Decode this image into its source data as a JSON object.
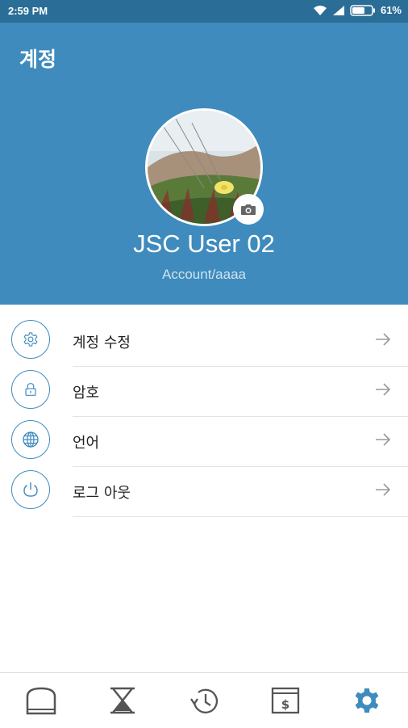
{
  "status_bar": {
    "time": "2:59 PM",
    "battery": "61%"
  },
  "header": {
    "title": "계정",
    "user_name": "JSC User 02",
    "account_id": "Account/aaaa"
  },
  "menu": {
    "items": [
      {
        "label": "계정 수정",
        "icon": "gear-icon"
      },
      {
        "label": "암호",
        "icon": "lock-icon"
      },
      {
        "label": "언어",
        "icon": "globe-icon"
      },
      {
        "label": "로그 아웃",
        "icon": "power-icon"
      }
    ]
  },
  "bottom_nav": {
    "items": [
      {
        "icon": "home-icon",
        "active": false
      },
      {
        "icon": "hourglass-icon",
        "active": false
      },
      {
        "icon": "history-icon",
        "active": false
      },
      {
        "icon": "money-icon",
        "active": false
      },
      {
        "icon": "settings-icon",
        "active": true
      }
    ]
  },
  "colors": {
    "primary": "#3f8bbd",
    "status_bar": "#2a6e97",
    "icon_gray": "#555555"
  }
}
